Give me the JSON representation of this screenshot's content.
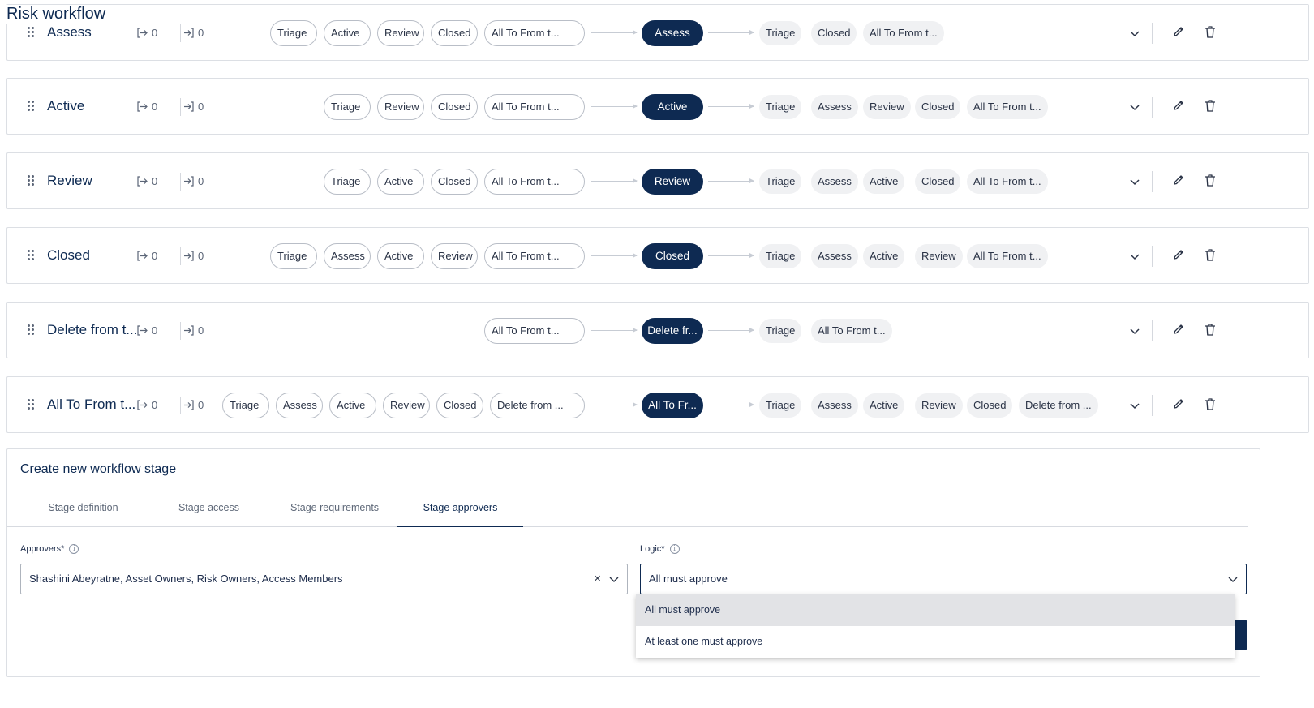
{
  "page": {
    "title": "Risk workflow"
  },
  "stages": [
    {
      "name": "Assess",
      "out_count": "0",
      "in_count": "0",
      "from": [
        "Triage",
        "Active",
        "Review",
        "Closed",
        "All To From t..."
      ],
      "current": "Assess",
      "to": [
        "Triage",
        "Closed",
        "All To From t..."
      ]
    },
    {
      "name": "Active",
      "out_count": "0",
      "in_count": "0",
      "from": [
        "Triage",
        "Review",
        "Closed",
        "All To From t..."
      ],
      "current": "Active",
      "to": [
        "Triage",
        "Assess",
        "Review",
        "Closed",
        "All To From t..."
      ]
    },
    {
      "name": "Review",
      "out_count": "0",
      "in_count": "0",
      "from": [
        "Triage",
        "Active",
        "Closed",
        "All To From t..."
      ],
      "current": "Review",
      "to": [
        "Triage",
        "Assess",
        "Active",
        "Closed",
        "All To From t..."
      ]
    },
    {
      "name": "Closed",
      "out_count": "0",
      "in_count": "0",
      "from": [
        "Triage",
        "Assess",
        "Active",
        "Review",
        "All To From t..."
      ],
      "current": "Closed",
      "to": [
        "Triage",
        "Assess",
        "Active",
        "Review",
        "All To From t..."
      ]
    },
    {
      "name": "Delete from t...",
      "out_count": "0",
      "in_count": "0",
      "from": [
        "All To From t..."
      ],
      "current": "Delete fr...",
      "to": [
        "Triage",
        "All To From t..."
      ]
    },
    {
      "name": "All To From t...",
      "out_count": "0",
      "in_count": "0",
      "from": [
        "Triage",
        "Assess",
        "Active",
        "Review",
        "Closed",
        "Delete from ..."
      ],
      "current": "All To Fr...",
      "to": [
        "Triage",
        "Assess",
        "Active",
        "Review",
        "Closed",
        "Delete from ..."
      ]
    }
  ],
  "create": {
    "title": "Create new workflow stage",
    "tabs": [
      "Stage definition",
      "Stage access",
      "Stage requirements",
      "Stage approvers"
    ],
    "active_tab": "Stage approvers",
    "approvers": {
      "label": "Approvers*",
      "value": "Shashini Abeyratne, Asset Owners, Risk Owners, Access Members",
      "clear": "×"
    },
    "logic": {
      "label": "Logic*",
      "value": "All must approve",
      "options": [
        "All must approve",
        "At least one must approve"
      ],
      "selected": "All must approve"
    }
  },
  "colors": {
    "primary": "#0e2a52",
    "border": "#dcdfe4",
    "dest_pill_bg": "#f0f1f3",
    "option_selected_bg": "#e2e3e6"
  }
}
